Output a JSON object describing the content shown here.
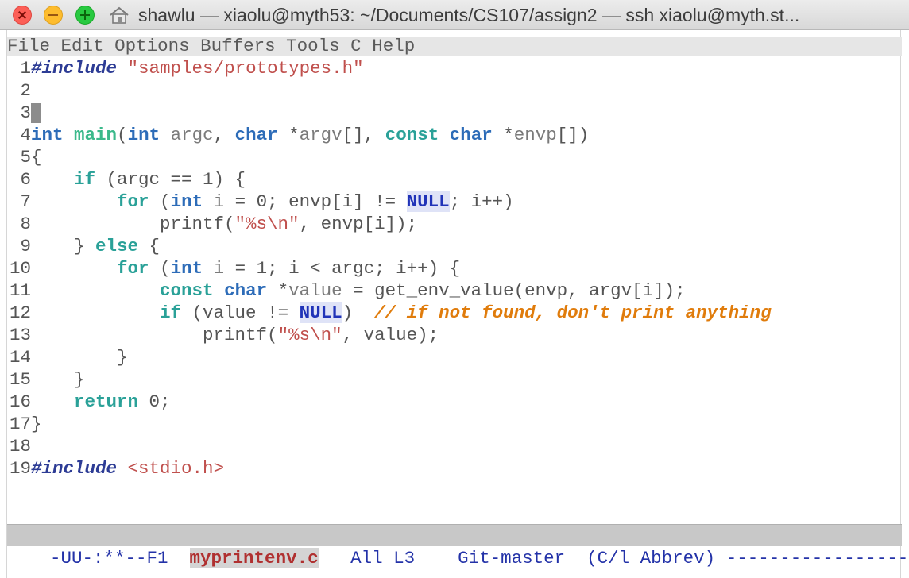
{
  "window": {
    "title": "shawlu — xiaolu@myth53: ~/Documents/CS107/assign2 — ssh xiaolu@myth.st..."
  },
  "menu": {
    "items": [
      "File",
      "Edit",
      "Options",
      "Buffers",
      "Tools",
      "C",
      "Help"
    ]
  },
  "editor": {
    "cursor_line": 3,
    "lines": [
      {
        "n": "1",
        "tokens": [
          {
            "t": "#include",
            "c": "pp"
          },
          {
            "t": " ",
            "c": "plain"
          },
          {
            "t": "\"samples/prototypes.h\"",
            "c": "str"
          }
        ]
      },
      {
        "n": "2",
        "tokens": []
      },
      {
        "n": "3",
        "tokens": [],
        "cursor": true
      },
      {
        "n": "4",
        "tokens": [
          {
            "t": "int",
            "c": "ty"
          },
          {
            "t": " ",
            "c": "plain"
          },
          {
            "t": "main",
            "c": "fn"
          },
          {
            "t": "(",
            "c": "plain"
          },
          {
            "t": "int",
            "c": "ty"
          },
          {
            "t": " ",
            "c": "plain"
          },
          {
            "t": "argc",
            "c": "var"
          },
          {
            "t": ", ",
            "c": "plain"
          },
          {
            "t": "char",
            "c": "ty"
          },
          {
            "t": " *",
            "c": "plain"
          },
          {
            "t": "argv",
            "c": "var"
          },
          {
            "t": "[], ",
            "c": "plain"
          },
          {
            "t": "const",
            "c": "kw"
          },
          {
            "t": " ",
            "c": "plain"
          },
          {
            "t": "char",
            "c": "ty"
          },
          {
            "t": " *",
            "c": "plain"
          },
          {
            "t": "envp",
            "c": "var"
          },
          {
            "t": "[])",
            "c": "plain"
          }
        ]
      },
      {
        "n": "5",
        "tokens": [
          {
            "t": "{",
            "c": "plain"
          }
        ]
      },
      {
        "n": "6",
        "tokens": [
          {
            "t": "    ",
            "c": "plain"
          },
          {
            "t": "if",
            "c": "kw"
          },
          {
            "t": " (argc == 1) {",
            "c": "plain"
          }
        ]
      },
      {
        "n": "7",
        "tokens": [
          {
            "t": "        ",
            "c": "plain"
          },
          {
            "t": "for",
            "c": "kw"
          },
          {
            "t": " (",
            "c": "plain"
          },
          {
            "t": "int",
            "c": "ty"
          },
          {
            "t": " ",
            "c": "plain"
          },
          {
            "t": "i",
            "c": "var"
          },
          {
            "t": " = 0; envp[i] != ",
            "c": "plain"
          },
          {
            "t": "NULL",
            "c": "cst"
          },
          {
            "t": "; i++)",
            "c": "plain"
          }
        ]
      },
      {
        "n": "8",
        "tokens": [
          {
            "t": "            printf(",
            "c": "plain"
          },
          {
            "t": "\"%s\\n\"",
            "c": "str"
          },
          {
            "t": ", envp[i]);",
            "c": "plain"
          }
        ]
      },
      {
        "n": "9",
        "tokens": [
          {
            "t": "    } ",
            "c": "plain"
          },
          {
            "t": "else",
            "c": "kw"
          },
          {
            "t": " {",
            "c": "plain"
          }
        ]
      },
      {
        "n": "10",
        "tokens": [
          {
            "t": "        ",
            "c": "plain"
          },
          {
            "t": "for",
            "c": "kw"
          },
          {
            "t": " (",
            "c": "plain"
          },
          {
            "t": "int",
            "c": "ty"
          },
          {
            "t": " ",
            "c": "plain"
          },
          {
            "t": "i",
            "c": "var"
          },
          {
            "t": " = 1; i < argc; i++) {",
            "c": "plain"
          }
        ]
      },
      {
        "n": "11",
        "tokens": [
          {
            "t": "            ",
            "c": "plain"
          },
          {
            "t": "const",
            "c": "kw"
          },
          {
            "t": " ",
            "c": "plain"
          },
          {
            "t": "char",
            "c": "ty"
          },
          {
            "t": " *",
            "c": "plain"
          },
          {
            "t": "value",
            "c": "var"
          },
          {
            "t": " = get_env_value(envp, argv[i]);",
            "c": "plain"
          }
        ]
      },
      {
        "n": "12",
        "tokens": [
          {
            "t": "            ",
            "c": "plain"
          },
          {
            "t": "if",
            "c": "kw"
          },
          {
            "t": " (value != ",
            "c": "plain"
          },
          {
            "t": "NULL",
            "c": "cst"
          },
          {
            "t": ")  ",
            "c": "plain"
          },
          {
            "t": "// if not found, don't print anything",
            "c": "cmt"
          }
        ]
      },
      {
        "n": "13",
        "tokens": [
          {
            "t": "                printf(",
            "c": "plain"
          },
          {
            "t": "\"%s\\n\"",
            "c": "str"
          },
          {
            "t": ", value);",
            "c": "plain"
          }
        ]
      },
      {
        "n": "14",
        "tokens": [
          {
            "t": "        }",
            "c": "plain"
          }
        ]
      },
      {
        "n": "15",
        "tokens": [
          {
            "t": "    }",
            "c": "plain"
          }
        ]
      },
      {
        "n": "16",
        "tokens": [
          {
            "t": "    ",
            "c": "plain"
          },
          {
            "t": "return",
            "c": "kw"
          },
          {
            "t": " 0;",
            "c": "plain"
          }
        ]
      },
      {
        "n": "17",
        "tokens": [
          {
            "t": "}",
            "c": "plain"
          }
        ]
      },
      {
        "n": "18",
        "tokens": []
      },
      {
        "n": "19",
        "tokens": [
          {
            "t": "#include",
            "c": "pp"
          },
          {
            "t": " ",
            "c": "plain"
          },
          {
            "t": "<stdio.h>",
            "c": "str"
          }
        ]
      }
    ]
  },
  "modeline": {
    "status": "-UU-:**--F1  ",
    "buffer": "myprintenv.c",
    "position": "   All L3    ",
    "vcs": "Git-master",
    "modes": "  (C/l Abbrev) ",
    "fill": "------------------"
  }
}
